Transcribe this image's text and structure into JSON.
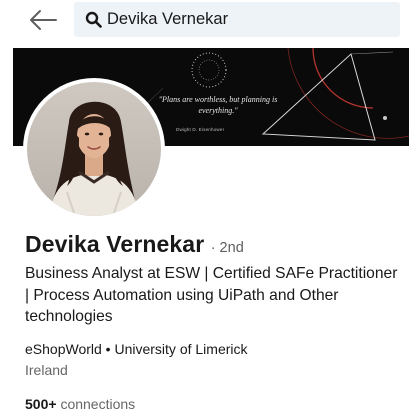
{
  "search": {
    "value": "Devika Vernekar",
    "back_icon": "arrow-left-icon",
    "search_icon": "search-icon"
  },
  "banner": {
    "quote": "\"Plans are worthless, but planning is everything.\"",
    "attribution": "Dwight D. Eisenhower"
  },
  "profile": {
    "name": "Devika Vernekar",
    "degree": "· 2nd",
    "headline": "Business Analyst at ESW | Certified SAFe Practitioner | Process Automation using UiPath and Other technologies",
    "org": "eShopWorld • University of Limerick",
    "location": "Ireland",
    "connections_count": "500+",
    "connections_label": "connections"
  },
  "colors": {
    "search_bg": "#eef3f8",
    "banner_bg": "#0a0a0a",
    "text_primary": "#191919",
    "text_secondary": "#666666"
  }
}
